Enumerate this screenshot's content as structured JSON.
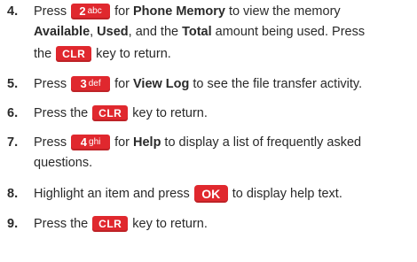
{
  "colors": {
    "key_red": "#e0282e",
    "text": "#2a2a2a"
  },
  "steps": [
    {
      "number": "4.",
      "line1": {
        "a": "Press",
        "key_digit": "2",
        "key_letters": "abc",
        "b": "for",
        "c": "Phone Memory",
        "d": "to view the memory"
      },
      "line2": {
        "a": "Available",
        "b": ",",
        "c": "Used",
        "d": ", and the",
        "e": "Total",
        "f": "amount being used. Press"
      },
      "line3": {
        "a": "the",
        "key": "CLR",
        "b": "key to return."
      }
    },
    {
      "number": "5.",
      "line1": {
        "a": "Press",
        "key_digit": "3",
        "key_letters": "def",
        "b": "for",
        "c": "View Log",
        "d": "to see the file transfer activity."
      }
    },
    {
      "number": "6.",
      "line1": {
        "a": "Press the",
        "key": "CLR",
        "b": "key to return."
      }
    },
    {
      "number": "7.",
      "line1": {
        "a": "Press",
        "key_digit": "4",
        "key_letters": "ghi",
        "b": "for",
        "c": "Help",
        "d": "to display a list of frequently asked"
      },
      "line2": {
        "a": "questions."
      }
    },
    {
      "number": "8.",
      "line1": {
        "a": "Highlight an item and press",
        "key": "OK",
        "b": "to display help text."
      }
    },
    {
      "number": "9.",
      "line1": {
        "a": "Press the",
        "key": "CLR",
        "b": "key to return."
      }
    }
  ]
}
